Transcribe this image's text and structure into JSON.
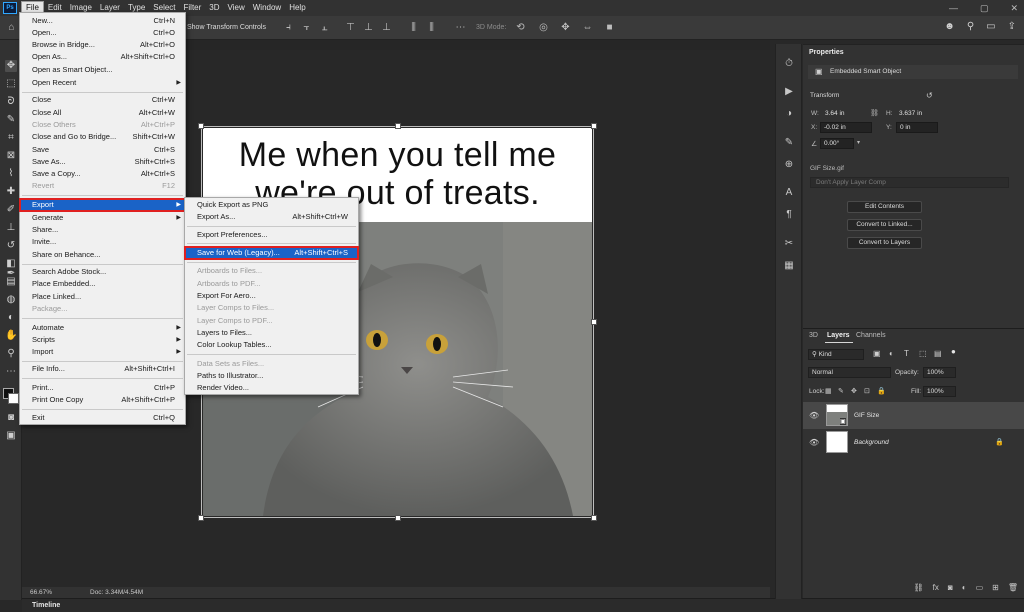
{
  "menubar": {
    "logo": "Ps",
    "items": [
      "File",
      "Edit",
      "Image",
      "Layer",
      "Type",
      "Select",
      "Filter",
      "3D",
      "View",
      "Window",
      "Help"
    ]
  },
  "optionsbar": {
    "show_transform": "Show Transform Controls",
    "mode_3d": "3D Mode:"
  },
  "file_menu": {
    "items": [
      {
        "label": "New...",
        "shortcut": "Ctrl+N"
      },
      {
        "label": "Open...",
        "shortcut": "Ctrl+O"
      },
      {
        "label": "Browse in Bridge...",
        "shortcut": "Alt+Ctrl+O"
      },
      {
        "label": "Open As...",
        "shortcut": "Alt+Shift+Ctrl+O"
      },
      {
        "label": "Open as Smart Object...",
        "shortcut": ""
      },
      {
        "label": "Open Recent",
        "shortcut": ""
      },
      {
        "label": "Close",
        "shortcut": "Ctrl+W"
      },
      {
        "label": "Close All",
        "shortcut": "Alt+Ctrl+W"
      },
      {
        "label": "Close Others",
        "shortcut": "Alt+Ctrl+P"
      },
      {
        "label": "Close and Go to Bridge...",
        "shortcut": "Shift+Ctrl+W"
      },
      {
        "label": "Save",
        "shortcut": "Ctrl+S"
      },
      {
        "label": "Save As...",
        "shortcut": "Shift+Ctrl+S"
      },
      {
        "label": "Save a Copy...",
        "shortcut": "Alt+Ctrl+S"
      },
      {
        "label": "Revert",
        "shortcut": "F12"
      },
      {
        "label": "Export",
        "shortcut": ""
      },
      {
        "label": "Generate",
        "shortcut": ""
      },
      {
        "label": "Share...",
        "shortcut": ""
      },
      {
        "label": "Invite...",
        "shortcut": ""
      },
      {
        "label": "Share on Behance...",
        "shortcut": ""
      },
      {
        "label": "Search Adobe Stock...",
        "shortcut": ""
      },
      {
        "label": "Place Embedded...",
        "shortcut": ""
      },
      {
        "label": "Place Linked...",
        "shortcut": ""
      },
      {
        "label": "Package...",
        "shortcut": ""
      },
      {
        "label": "Automate",
        "shortcut": ""
      },
      {
        "label": "Scripts",
        "shortcut": ""
      },
      {
        "label": "Import",
        "shortcut": ""
      },
      {
        "label": "File Info...",
        "shortcut": "Alt+Shift+Ctrl+I"
      },
      {
        "label": "Print...",
        "shortcut": "Ctrl+P"
      },
      {
        "label": "Print One Copy",
        "shortcut": "Alt+Shift+Ctrl+P"
      },
      {
        "label": "Exit",
        "shortcut": "Ctrl+Q"
      }
    ]
  },
  "export_menu": {
    "items": [
      {
        "label": "Quick Export as PNG",
        "shortcut": ""
      },
      {
        "label": "Export As...",
        "shortcut": "Alt+Shift+Ctrl+W"
      },
      {
        "label": "Export Preferences...",
        "shortcut": ""
      },
      {
        "label": "Save for Web (Legacy)...",
        "shortcut": "Alt+Shift+Ctrl+S"
      },
      {
        "label": "Artboards to Files...",
        "shortcut": ""
      },
      {
        "label": "Artboards to PDF...",
        "shortcut": ""
      },
      {
        "label": "Export For Aero...",
        "shortcut": ""
      },
      {
        "label": "Layer Comps to Files...",
        "shortcut": ""
      },
      {
        "label": "Layer Comps to PDF...",
        "shortcut": ""
      },
      {
        "label": "Layers to Files...",
        "shortcut": ""
      },
      {
        "label": "Color Lookup Tables...",
        "shortcut": ""
      },
      {
        "label": "Data Sets as Files...",
        "shortcut": ""
      },
      {
        "label": "Paths to Illustrator...",
        "shortcut": ""
      },
      {
        "label": "Render Video...",
        "shortcut": ""
      }
    ]
  },
  "document": {
    "caption_line1": "Me when you tell me",
    "caption_line2": "we're out of treats."
  },
  "status": {
    "zoom": "66.67%",
    "doc": "Doc: 3.34M/4.54M"
  },
  "timeline": {
    "label": "Timeline"
  },
  "properties": {
    "tab": "Properties",
    "kind": "Embedded Smart Object",
    "transform": "Transform",
    "w_label": "W:",
    "w": "3.64 in",
    "h_label": "H:",
    "h": "3.637 in",
    "x_label": "X:",
    "x": "-0.02 in",
    "y_label": "Y:",
    "y": "0 in",
    "angle": "0.00°",
    "file": "GIF Size.gif",
    "layer_comp": "Don't Apply Layer Comp",
    "btn_edit": "Edit Contents",
    "btn_convert_linked": "Convert to Linked...",
    "btn_convert_layers": "Convert to Layers"
  },
  "layers": {
    "tabs": [
      "3D",
      "Layers",
      "Channels"
    ],
    "filter": "Kind",
    "blend": "Normal",
    "opacity_label": "Opacity:",
    "opacity": "100%",
    "lock_label": "Lock:",
    "fill_label": "Fill:",
    "fill": "100%",
    "rows": [
      {
        "name": "GIF Size"
      },
      {
        "name": "Background"
      }
    ]
  },
  "colors": {
    "highlight": "#1a63c7",
    "outline": "#e02020"
  }
}
